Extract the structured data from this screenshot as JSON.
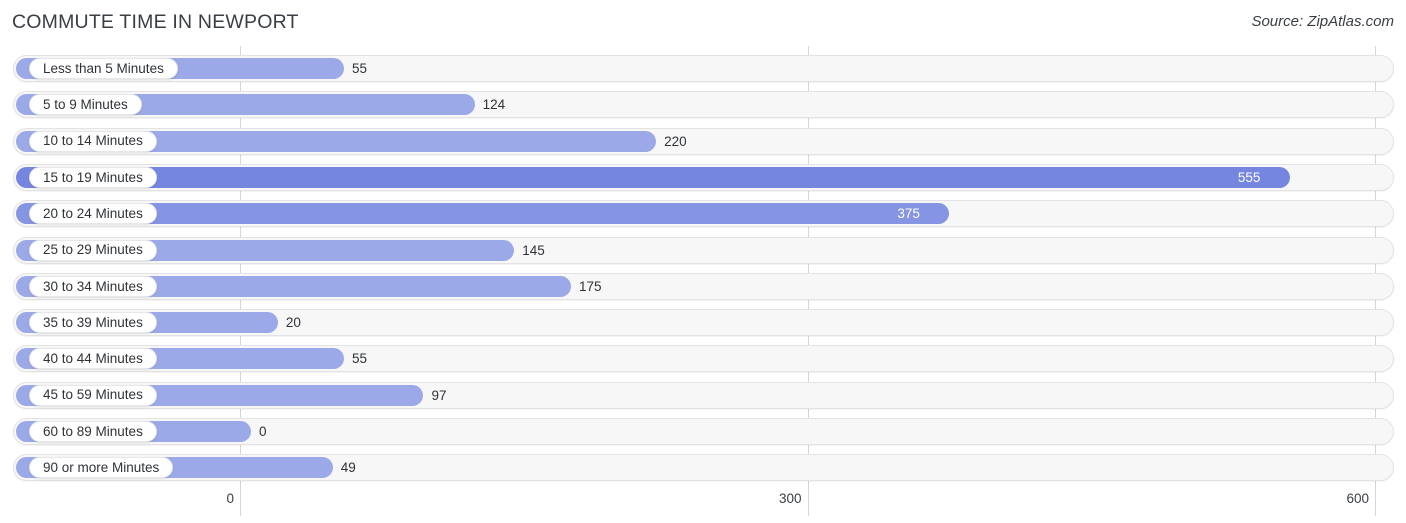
{
  "header": {
    "title": "COMMUTE TIME IN NEWPORT",
    "source": "Source: ZipAtlas.com"
  },
  "colors": {
    "bar": "#9ca9e8",
    "bar_highlight": "#7586e0",
    "bar_highlight2": "#8694e4",
    "track": "#f7f7f7",
    "gridline": "#d6d6d6",
    "text": "#2f3337"
  },
  "chart_data": {
    "type": "bar",
    "orientation": "horizontal",
    "title": "COMMUTE TIME IN NEWPORT",
    "xlabel": "",
    "ylabel": "",
    "xlim": [
      0,
      600
    ],
    "xticks": [
      0,
      300,
      600
    ],
    "xtick_labels": [
      "0",
      "300",
      "600"
    ],
    "grid": true,
    "legend": false,
    "categories": [
      "Less than 5 Minutes",
      "5 to 9 Minutes",
      "10 to 14 Minutes",
      "15 to 19 Minutes",
      "20 to 24 Minutes",
      "25 to 29 Minutes",
      "30 to 34 Minutes",
      "35 to 39 Minutes",
      "40 to 44 Minutes",
      "45 to 59 Minutes",
      "60 to 89 Minutes",
      "90 or more Minutes"
    ],
    "values": [
      55,
      124,
      220,
      555,
      375,
      145,
      175,
      20,
      55,
      97,
      0,
      49
    ],
    "value_labels": [
      "55",
      "124",
      "220",
      "555",
      "375",
      "145",
      "175",
      "20",
      "55",
      "97",
      "0",
      "49"
    ]
  },
  "rows": [
    {
      "label": "Less than 5 Minutes",
      "value": 55,
      "value_label": "55",
      "style": "normal",
      "label_inside": false
    },
    {
      "label": "5 to 9 Minutes",
      "value": 124,
      "value_label": "124",
      "style": "normal",
      "label_inside": false
    },
    {
      "label": "10 to 14 Minutes",
      "value": 220,
      "value_label": "220",
      "style": "normal",
      "label_inside": false
    },
    {
      "label": "15 to 19 Minutes",
      "value": 555,
      "value_label": "555",
      "style": "highlight",
      "label_inside": true
    },
    {
      "label": "20 to 24 Minutes",
      "value": 375,
      "value_label": "375",
      "style": "highlight2",
      "label_inside": true
    },
    {
      "label": "25 to 29 Minutes",
      "value": 145,
      "value_label": "145",
      "style": "normal",
      "label_inside": false
    },
    {
      "label": "30 to 34 Minutes",
      "value": 175,
      "value_label": "175",
      "style": "normal",
      "label_inside": false
    },
    {
      "label": "35 to 39 Minutes",
      "value": 20,
      "value_label": "20",
      "style": "normal",
      "label_inside": false
    },
    {
      "label": "40 to 44 Minutes",
      "value": 55,
      "value_label": "55",
      "style": "normal",
      "label_inside": false
    },
    {
      "label": "45 to 59 Minutes",
      "value": 97,
      "value_label": "97",
      "style": "normal",
      "label_inside": false
    },
    {
      "label": "60 to 89 Minutes",
      "value": 0,
      "value_label": "0",
      "style": "normal",
      "label_inside": false
    },
    {
      "label": "90 or more Minutes",
      "value": 49,
      "value_label": "49",
      "style": "normal",
      "label_inside": false
    }
  ],
  "axis": {
    "ticks": [
      {
        "label": "0",
        "value": 0
      },
      {
        "label": "300",
        "value": 300
      },
      {
        "label": "600",
        "value": 600
      }
    ]
  }
}
